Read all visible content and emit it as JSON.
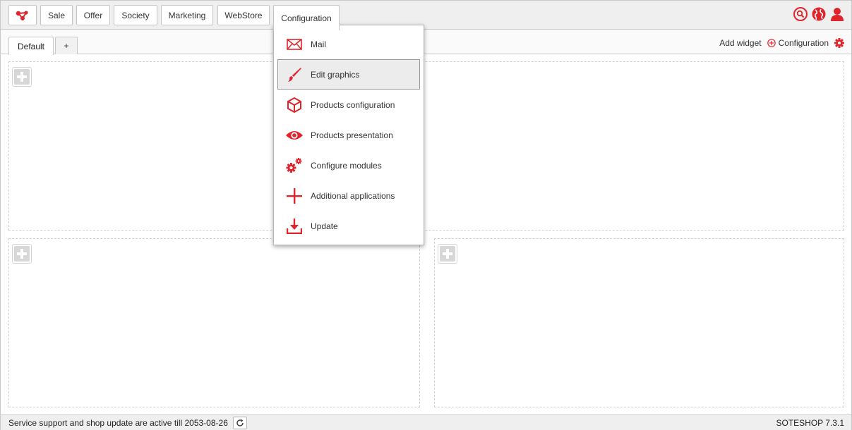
{
  "colors": {
    "accent": "#e0242b"
  },
  "nav": {
    "logo_icon": "soteshop-logo-icon",
    "items": [
      {
        "label": "Sale"
      },
      {
        "label": "Offer"
      },
      {
        "label": "Society"
      },
      {
        "label": "Marketing"
      },
      {
        "label": "WebStore"
      },
      {
        "label": "Configuration",
        "active": true
      }
    ],
    "right_icons": [
      "search-icon",
      "globe-icon",
      "user-icon"
    ]
  },
  "tabs": {
    "items": [
      {
        "label": "Default",
        "active": true
      },
      {
        "label": "+"
      }
    ],
    "add_widget": "Add widget",
    "configuration": "Configuration"
  },
  "configuration_menu": {
    "items": [
      {
        "label": "Mail",
        "icon": "mail-icon"
      },
      {
        "label": "Edit graphics",
        "icon": "brush-icon",
        "hovered": true
      },
      {
        "label": "Products configuration",
        "icon": "box-icon"
      },
      {
        "label": "Products presentation",
        "icon": "eye-icon"
      },
      {
        "label": "Configure modules",
        "icon": "gears-icon"
      },
      {
        "label": "Additional applications",
        "icon": "plus-icon"
      },
      {
        "label": "Update",
        "icon": "download-icon"
      }
    ]
  },
  "footer": {
    "status": "Service support and shop update are active till 2053-08-26",
    "version": "SOTESHOP 7.3.1"
  }
}
